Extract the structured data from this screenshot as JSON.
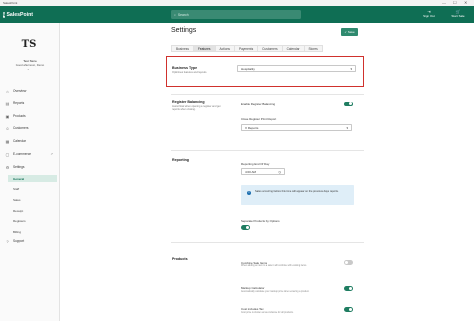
{
  "window": {
    "title": "SalesPoint",
    "minimize": "—",
    "maximize": "☐",
    "close": "✕"
  },
  "appbar": {
    "brand": "SalesPoint",
    "search_placeholder": "Search",
    "sign_out": "Sign Out",
    "start_sale": "Start Sale"
  },
  "user": {
    "logo_text": "TS",
    "name": "Test Store",
    "greeting": "Good afternoon, Demo",
    "caret": "⌄"
  },
  "nav": [
    {
      "label": "Overview",
      "icon": "home-icon",
      "glyph": "⌂"
    },
    {
      "label": "Reports",
      "icon": "chart-icon",
      "glyph": "▤"
    },
    {
      "label": "Products",
      "icon": "tag-icon",
      "glyph": "▣"
    },
    {
      "label": "Customers",
      "icon": "person-icon",
      "glyph": "☺"
    },
    {
      "label": "Calendar",
      "icon": "calendar-icon",
      "glyph": "▦"
    },
    {
      "label": "E-commerce",
      "icon": "cart-icon",
      "glyph": "▢",
      "ext": "↗"
    },
    {
      "label": "Settings",
      "icon": "gear-icon",
      "glyph": "⚙"
    }
  ],
  "settings_subnav": [
    "General",
    "Staff",
    "Sales",
    "Receipt",
    "Registers",
    "Billing"
  ],
  "support": {
    "label": "Support",
    "glyph": "?"
  },
  "page": {
    "title": "Settings",
    "save_label": "Save",
    "tabs": [
      "Business",
      "Features",
      "Actions",
      "Payments",
      "Customers",
      "Calendar",
      "Stores"
    ],
    "active_tab": "Features"
  },
  "business_type": {
    "title": "Business Type",
    "desc": "Optimises features and layouts.",
    "value": "Hospitality"
  },
  "register_balancing": {
    "title": "Register Balancing",
    "desc": "Assist float when opening a register and get reports when closing.",
    "enable_label": "Enable Register Balancing",
    "enable_on": true,
    "close_print_label": "Close Register Print Report",
    "close_print_value": "X Reports"
  },
  "reporting": {
    "title": "Reporting",
    "end_of_day_label": "Reporting End Of Day",
    "end_of_day_value": "4:00 AM",
    "info_text": "Sales occurring before this time will appear on the previous days reports.",
    "separate_label": "Separate Products by Options",
    "separate_on": true
  },
  "products": {
    "title": "Products",
    "combine_label": "Combine Sale Items",
    "combine_desc": "When adding an item to a sale it will combine with existing items.",
    "combine_on": false,
    "markup_label": "Markup Calculator",
    "markup_desc": "Automatically calculate your markup price when entering a product.",
    "markup_on": true,
    "cost_tax_label": "Cost includes Tax",
    "cost_tax_desc": "Cost price is shown as tax-inclusive for all products.",
    "cost_tax_on": true
  }
}
